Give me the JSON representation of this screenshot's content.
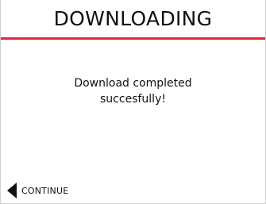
{
  "header": {
    "title": "DOWNLOADING",
    "accent_color": "#e0273a"
  },
  "message": {
    "line1": "Download completed",
    "line2": "succesfully!"
  },
  "footer": {
    "continue_label": "CONTINUE",
    "continue_icon": "back-arrow-icon"
  }
}
